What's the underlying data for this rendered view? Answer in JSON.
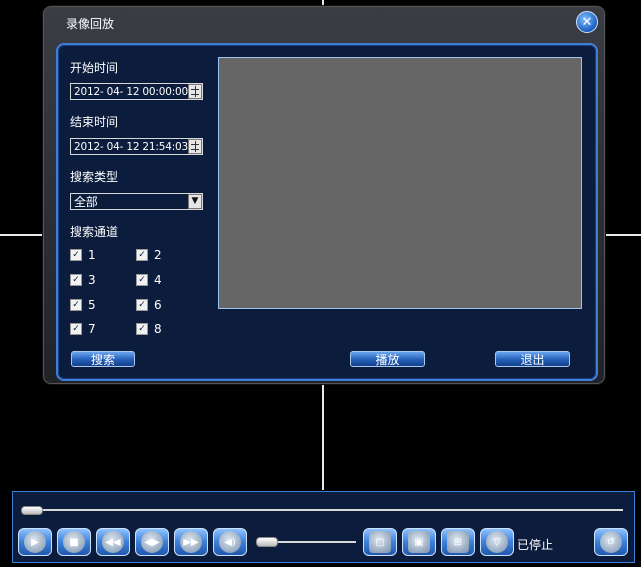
{
  "dialog": {
    "title": "录像回放",
    "close_glyph": "✕",
    "start_time_label": "开始时间",
    "start_time_value": "2012- 04- 12 00:00:00",
    "end_time_label": "结束时间",
    "end_time_value": "2012- 04- 12 21:54:03",
    "search_type_label": "搜索类型",
    "search_type_value": "全部",
    "search_channel_label": "搜索通道",
    "channels": [
      {
        "label": "1",
        "checked": true
      },
      {
        "label": "2",
        "checked": true
      },
      {
        "label": "3",
        "checked": true
      },
      {
        "label": "4",
        "checked": true
      },
      {
        "label": "5",
        "checked": true
      },
      {
        "label": "6",
        "checked": true
      },
      {
        "label": "7",
        "checked": true
      },
      {
        "label": "8",
        "checked": true
      }
    ],
    "search_button": "搜索",
    "play_button": "播放",
    "exit_button": "退出"
  },
  "playback": {
    "status": "已停止",
    "progress": 0,
    "volume": 0,
    "icons": [
      "play-icon",
      "stop-icon",
      "rewind-icon",
      "slow-icon",
      "fast-forward-icon",
      "volume-icon",
      "layout-1-icon",
      "layout-4-icon",
      "layout-9-icon",
      "layout-16-icon",
      "back-icon"
    ]
  },
  "colors": {
    "panel_bg": "#0b1c3c",
    "accent": "#3e7fd6",
    "button_blue": "#245fb8"
  }
}
